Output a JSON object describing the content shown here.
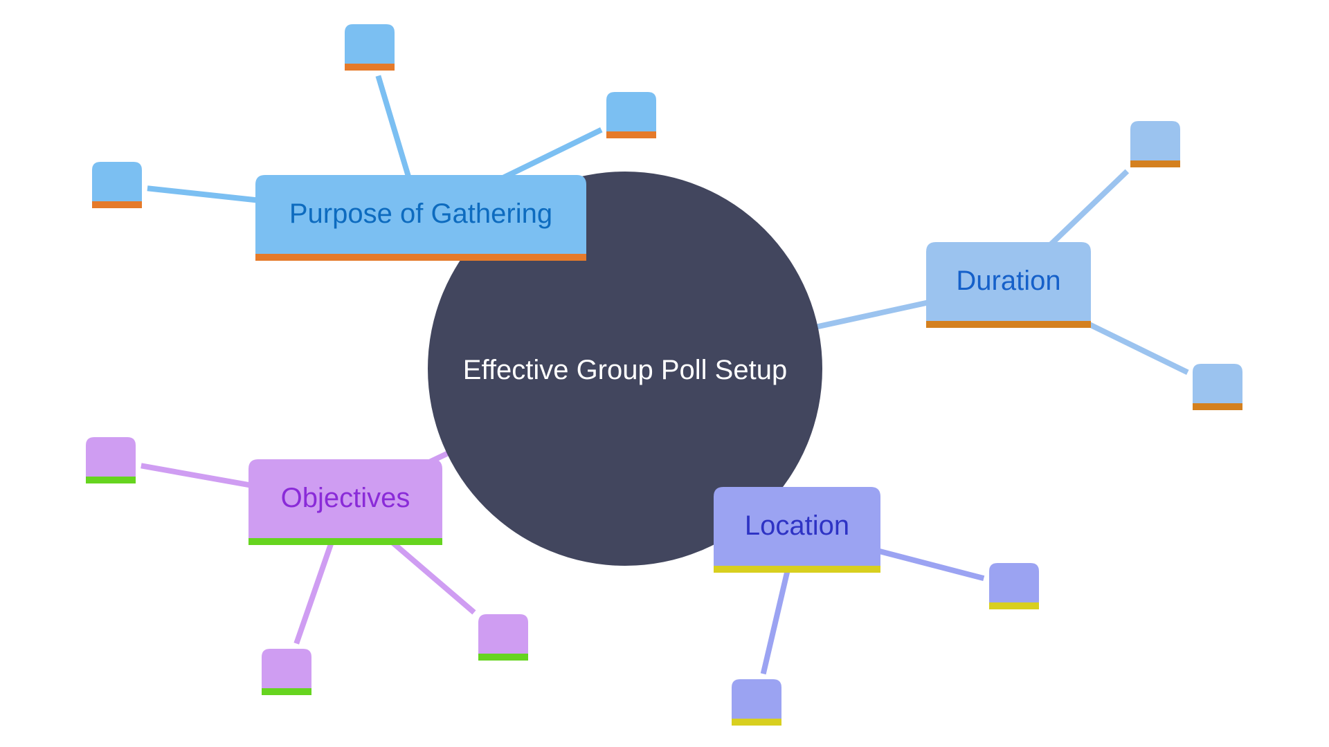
{
  "diagram": {
    "type": "mindmap",
    "root": {
      "label": "Effective Group Poll Setup",
      "fill": "#42465E",
      "text_color": "#FFFFFF"
    },
    "branches": [
      {
        "id": "purpose",
        "label": "Purpose of Gathering",
        "fill": "#7BBFF2",
        "text_color": "#0D6BBF",
        "bar_color": "#E57A2A",
        "line_color": "#7BBFF2",
        "children": [
          {
            "label": ""
          },
          {
            "label": ""
          },
          {
            "label": ""
          }
        ]
      },
      {
        "id": "duration",
        "label": "Duration",
        "fill": "#9BC3EF",
        "text_color": "#1560C9",
        "bar_color": "#D4801F",
        "line_color": "#9BC3EF",
        "children": [
          {
            "label": ""
          },
          {
            "label": ""
          }
        ]
      },
      {
        "id": "location",
        "label": "Location",
        "fill": "#9BA3F2",
        "text_color": "#2E33C4",
        "bar_color": "#D8CF1F",
        "line_color": "#9BA3F2",
        "children": [
          {
            "label": ""
          },
          {
            "label": ""
          }
        ]
      },
      {
        "id": "objectives",
        "label": "Objectives",
        "fill": "#CF9DF2",
        "text_color": "#8A2BD8",
        "bar_color": "#66D41F",
        "line_color": "#CF9DF2",
        "children": [
          {
            "label": ""
          },
          {
            "label": ""
          },
          {
            "label": ""
          }
        ]
      }
    ]
  }
}
